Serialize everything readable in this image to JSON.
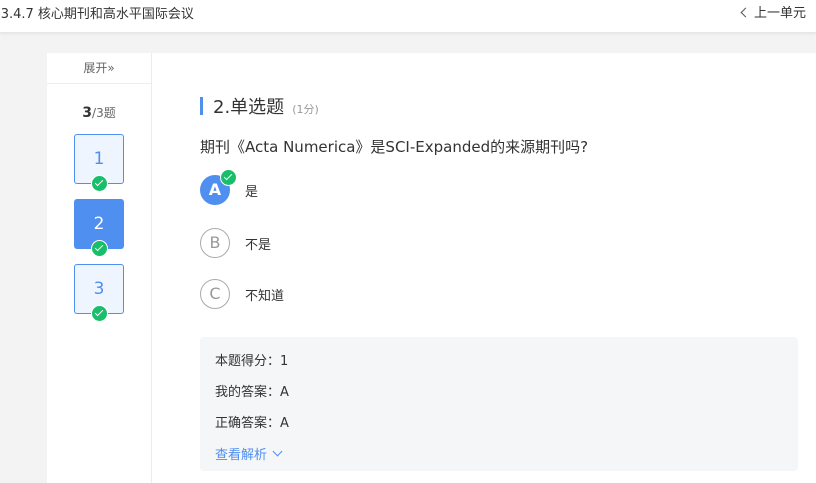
{
  "header": {
    "title": "-3.4.7 核心期刊和高水平国际会议",
    "prev_unit": "上一单元"
  },
  "sidebar": {
    "expand_label": "展开»",
    "progress_current": "3",
    "progress_total": "/3题",
    "questions": [
      {
        "number": "1",
        "answered": true,
        "active": false
      },
      {
        "number": "2",
        "answered": true,
        "active": true
      },
      {
        "number": "3",
        "answered": true,
        "active": false
      }
    ]
  },
  "question": {
    "heading": "2.单选题",
    "score": "(1分)",
    "stem": "期刊《Acta Numerica》是SCI-Expanded的来源期刊吗?",
    "options": [
      {
        "letter": "A",
        "text": "是",
        "selected": true,
        "correct": true
      },
      {
        "letter": "B",
        "text": "不是",
        "selected": false
      },
      {
        "letter": "C",
        "text": "不知道",
        "selected": false
      }
    ]
  },
  "result": {
    "score_line": "本题得分：1",
    "my_answer_line": "我的答案：A",
    "correct_answer_line": "正确答案：A",
    "analysis_link": "查看解析"
  },
  "colors": {
    "accent": "#4f8ff0",
    "success": "#19be6b",
    "panel_bg": "#f5f6f7",
    "page_bg": "#f3f3f3"
  },
  "icons": {
    "prev": "chevron-left-icon",
    "check": "check-circle-icon",
    "expand_analysis": "chevron-down-icon"
  }
}
